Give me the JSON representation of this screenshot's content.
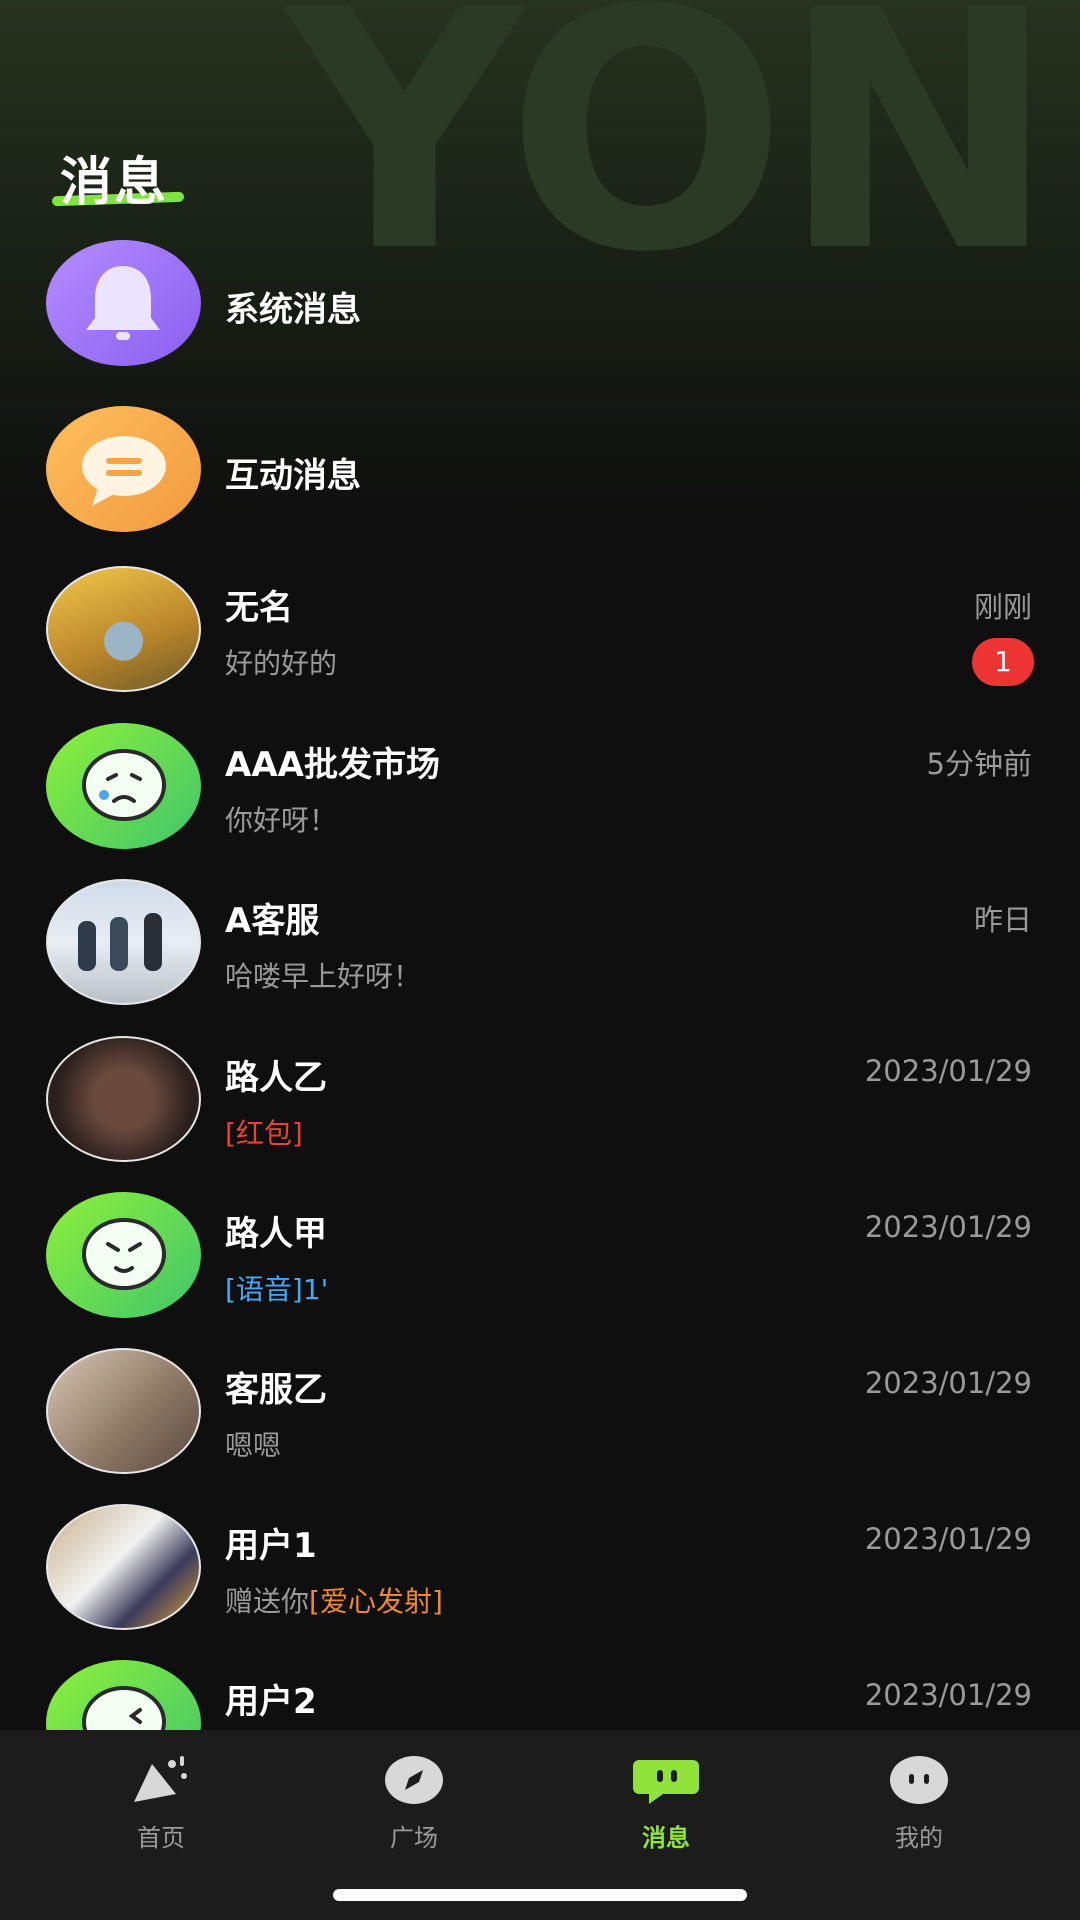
{
  "header": {
    "watermark": "YON",
    "title": "消息"
  },
  "system_items": [
    {
      "name": "系统消息",
      "icon": "bell-icon"
    },
    {
      "name": "互动消息",
      "icon": "chat-bubble-icon"
    }
  ],
  "conversations": [
    {
      "name": "无名",
      "preview": "好的好的",
      "time": "刚刚",
      "unread": "1"
    },
    {
      "name": "AAA批发市场",
      "preview": "你好呀！",
      "time": "5分钟前"
    },
    {
      "name": "A客服",
      "preview": "哈喽早上好呀！",
      "time": "昨日"
    },
    {
      "name": "路人乙",
      "preview_tag": "[红包]",
      "time": "2023/01/29"
    },
    {
      "name": "路人甲",
      "preview_tag": "[语音]",
      "preview_suffix": "1'",
      "time": "2023/01/29"
    },
    {
      "name": "客服乙",
      "preview": "嗯嗯",
      "time": "2023/01/29"
    },
    {
      "name": "用户1",
      "preview": "赠送你",
      "preview_tag": "[爱心发射]",
      "time": "2023/01/29"
    },
    {
      "name": "用户2",
      "time": "2023/01/29"
    }
  ],
  "tabbar": {
    "items": [
      {
        "label": "首页",
        "icon": "home-confetti-icon"
      },
      {
        "label": "广场",
        "icon": "compass-icon"
      },
      {
        "label": "消息",
        "icon": "message-icon",
        "active": true
      },
      {
        "label": "我的",
        "icon": "profile-face-icon"
      }
    ]
  },
  "colors": {
    "accent": "#8fe33a",
    "badge": "#ef3434",
    "tag_red": "#e8413a",
    "tag_blue": "#4aa6f0",
    "tag_orange": "#f0892e",
    "background": "#0f0f0f"
  }
}
